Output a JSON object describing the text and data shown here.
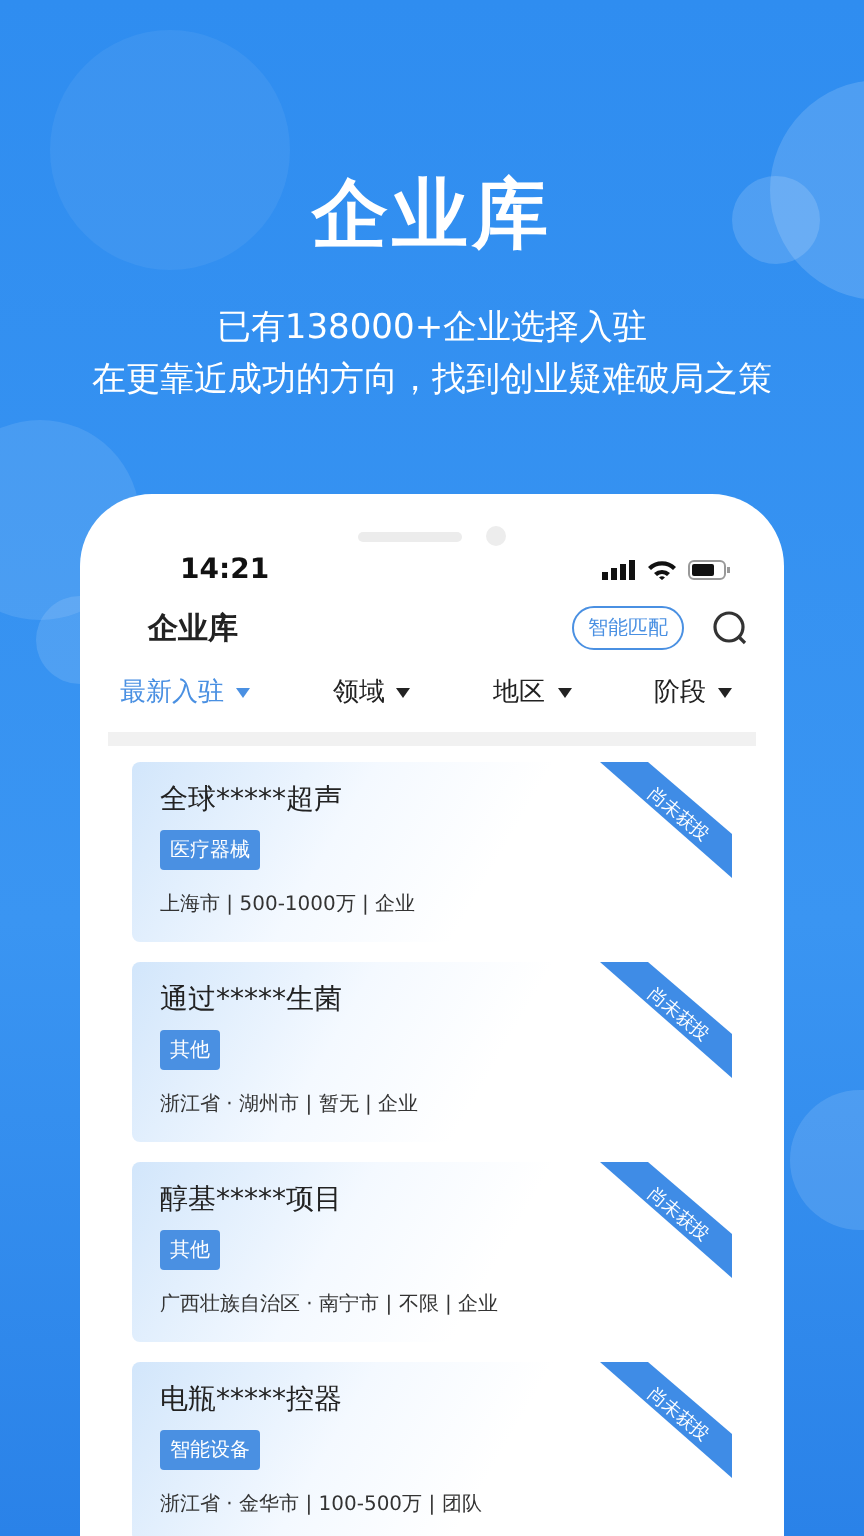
{
  "hero": {
    "title": "企业库",
    "lines": [
      "已有138000+企业选择入驻",
      "在更靠近成功的方向，找到创业疑难破局之策"
    ]
  },
  "phone": {
    "status_bar": {
      "time": "14:21"
    },
    "header": {
      "title": "企业库",
      "match_button": "智能匹配"
    },
    "filters": [
      {
        "label": "最新入驻",
        "selected": true
      },
      {
        "label": "领域",
        "selected": false
      },
      {
        "label": "地区",
        "selected": false
      },
      {
        "label": "阶段",
        "selected": false
      }
    ],
    "companies": [
      {
        "name": "全球*****超声",
        "tag": "医疗器械",
        "info": "上海市 | 500-1000万 | 企业",
        "ribbon": "尚未获投"
      },
      {
        "name": "通过*****生菌",
        "tag": "其他",
        "info": "浙江省 · 湖州市 | 暂无 | 企业",
        "ribbon": "尚未获投"
      },
      {
        "name": "醇基*****项目",
        "tag": "其他",
        "info": "广西壮族自治区 · 南宁市 | 不限 | 企业",
        "ribbon": "尚未获投"
      },
      {
        "name": "电瓶*****控器",
        "tag": "智能设备",
        "info": "浙江省 · 金华市 | 100-500万 | 团队",
        "ribbon": "尚未获投"
      }
    ]
  }
}
